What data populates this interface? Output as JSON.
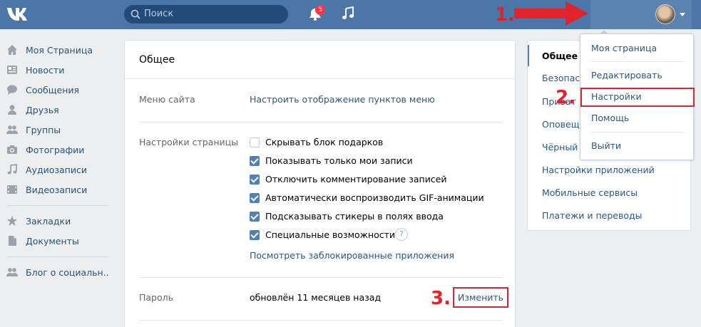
{
  "header": {
    "search_placeholder": "Поиск",
    "notifications_count": "5",
    "accent_color": "#4a76a8"
  },
  "leftnav": {
    "items": [
      {
        "label": "Моя Страница",
        "icon": "home-icon"
      },
      {
        "label": "Новости",
        "icon": "news-icon"
      },
      {
        "label": "Сообщения",
        "icon": "messages-icon"
      },
      {
        "label": "Друзья",
        "icon": "friend-icon"
      },
      {
        "label": "Группы",
        "icon": "groups-icon"
      },
      {
        "label": "Фотографии",
        "icon": "camera-icon"
      },
      {
        "label": "Аудиозаписи",
        "icon": "music-icon"
      },
      {
        "label": "Видеозаписи",
        "icon": "video-icon"
      },
      {
        "label": "Закладки",
        "icon": "star-icon"
      },
      {
        "label": "Документы",
        "icon": "document-icon"
      },
      {
        "label": "Блог о социальн..",
        "icon": "groups-icon"
      }
    ]
  },
  "main": {
    "title": "Общее",
    "site_menu": {
      "label": "Меню сайта",
      "value": "Настроить отображение пунктов меню"
    },
    "page_settings": {
      "label": "Настройки страницы",
      "options": [
        {
          "label": "Скрывать блок подарков",
          "checked": false
        },
        {
          "label": "Показывать только мои записи",
          "checked": true
        },
        {
          "label": "Отключить комментирование записей",
          "checked": true
        },
        {
          "label": "Автоматически воспроизводить GIF-анимации",
          "checked": true
        },
        {
          "label": "Подсказывать стикеры в полях ввода",
          "checked": true
        },
        {
          "label": "Специальные возможности",
          "checked": true
        }
      ],
      "help": "?",
      "blocked_apps_link": "Посмотреть заблокированные приложения"
    },
    "password": {
      "label": "Пароль",
      "value": "обновлён 11 месяцев назад",
      "change": "Изменить"
    }
  },
  "rightmenu": {
    "items": [
      {
        "label": "Общее",
        "active": true
      },
      {
        "label": "Безопасн"
      },
      {
        "label": "Приват"
      },
      {
        "label": "Оповещ"
      },
      {
        "label": "Чёрный с"
      },
      {
        "label": "Настройки приложений"
      },
      {
        "label": "Мобильные сервисы"
      },
      {
        "label": "Платежи и переводы"
      }
    ]
  },
  "dropdown": {
    "items": [
      "Моя страница",
      "Редактировать",
      "Настройки",
      "Помощь",
      "Выйти"
    ]
  },
  "annotations": {
    "step1": "1.",
    "step2": "2.",
    "step3": "3.",
    "color": "#e2232b"
  }
}
